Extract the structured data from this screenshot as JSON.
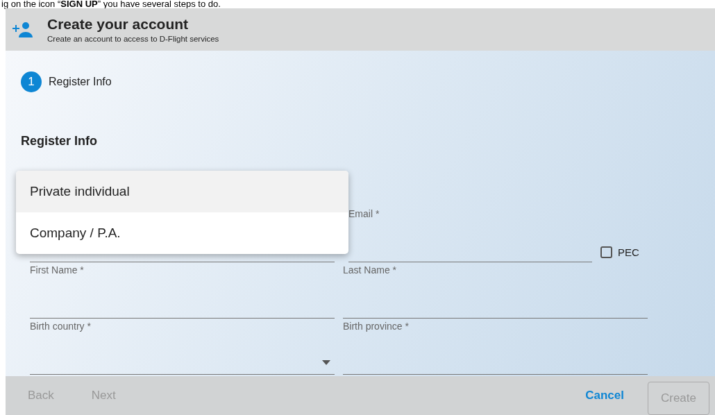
{
  "caption": "ig on the icon “**SIGN UP**” you have several steps to do.",
  "dialog": {
    "title": "Create your account",
    "subtitle": "Create an account to access to D-Flight services"
  },
  "stepper": [
    {
      "number": "1",
      "label": "Register Info",
      "selected": true
    }
  ],
  "section_title": "Register Info",
  "user_type": {
    "expanded": true,
    "options": [
      {
        "label": "Private individual",
        "selected": true
      },
      {
        "label": "Company / P.A.",
        "selected": false
      }
    ]
  },
  "email": {
    "label": "Email *",
    "pec": {
      "label": "PEC",
      "checked": false
    }
  },
  "fields": [
    {
      "label": "First Name *",
      "kind": "text"
    },
    {
      "label": "Last Name *",
      "kind": "text"
    },
    {
      "label": "Birth country *",
      "kind": "select"
    },
    {
      "label": "Birth province *",
      "kind": "text"
    }
  ],
  "footer": {
    "back": {
      "label": "Back",
      "disabled": true
    },
    "next": {
      "label": "Next",
      "disabled": true
    },
    "cancel": {
      "label": "Cancel",
      "disabled": false
    },
    "create": {
      "label": "Create",
      "disabled": true
    }
  }
}
